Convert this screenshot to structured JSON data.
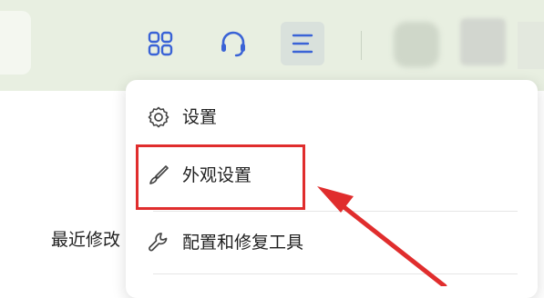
{
  "menu": {
    "items": [
      {
        "label": "设置",
        "icon": "gear-icon"
      },
      {
        "label": "外观设置",
        "icon": "brush-icon"
      },
      {
        "label": "配置和修复工具",
        "icon": "wrench-icon"
      }
    ]
  },
  "main": {
    "recent_label": "最近修改"
  },
  "toolbar": {
    "icons": [
      "grid-apps-icon",
      "headset-icon",
      "hamburger-menu-icon"
    ]
  },
  "colors": {
    "accent": "#3a63d6",
    "topbar_bg": "#e8efe1",
    "annotation_red": "#e02d2d"
  }
}
